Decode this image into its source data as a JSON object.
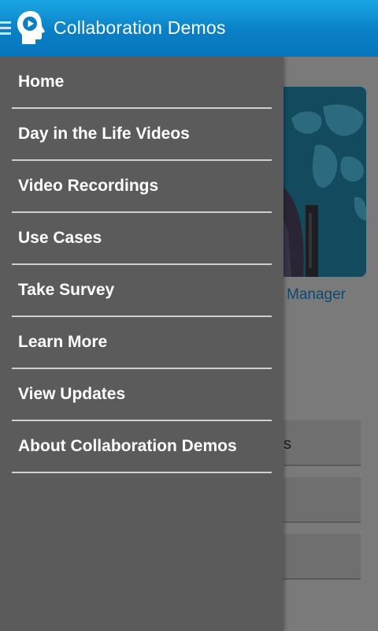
{
  "app_bar": {
    "title": "Collaboration Demos",
    "menu_icon": "hamburger-icon",
    "logo_icon": "head-play-logo-icon"
  },
  "drawer": {
    "items": [
      {
        "label": "Home"
      },
      {
        "label": "Day in the Life Videos"
      },
      {
        "label": "Video Recordings"
      },
      {
        "label": "Use Cases"
      },
      {
        "label": "Take Survey"
      },
      {
        "label": "Learn More"
      },
      {
        "label": "View Updates"
      },
      {
        "label": "About Collaboration Demos"
      }
    ]
  },
  "background": {
    "card_caption": "Manager",
    "button_fragment": "s"
  },
  "colors": {
    "app_bar": "#0a7fc6",
    "drawer": "#5b5b5b",
    "divider": "#cfcfcf",
    "caption": "#0c4a74"
  }
}
